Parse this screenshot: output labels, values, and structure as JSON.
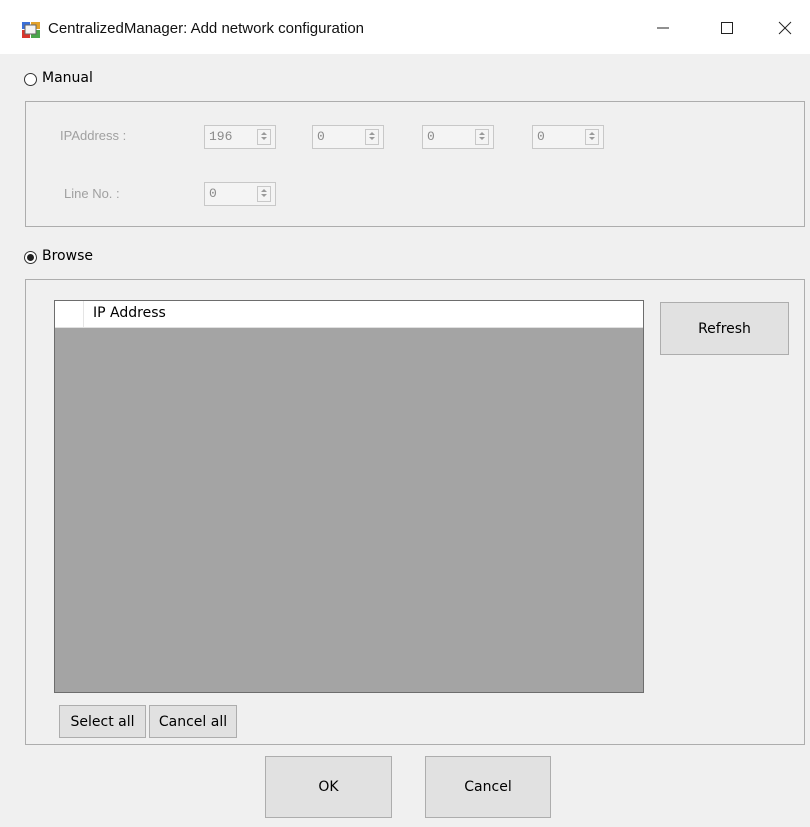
{
  "window": {
    "title": "CentralizedManager: Add network configuration",
    "icons": {
      "app": "app-icon",
      "minimize": "minimize-icon",
      "maximize": "maximize-icon",
      "close": "close-icon"
    }
  },
  "manual": {
    "label": "Manual",
    "selected": false,
    "ip_label": "IPAddress :",
    "ip_values": [
      "196",
      "0",
      "0",
      "0"
    ],
    "line_label": "Line No. :",
    "line_value": "0"
  },
  "browse": {
    "label": "Browse",
    "selected": true,
    "list_header": "IP Address",
    "refresh_label": "Refresh",
    "select_all_label": "Select all",
    "cancel_all_label": "Cancel all"
  },
  "footer": {
    "ok_label": "OK",
    "cancel_label": "Cancel"
  }
}
